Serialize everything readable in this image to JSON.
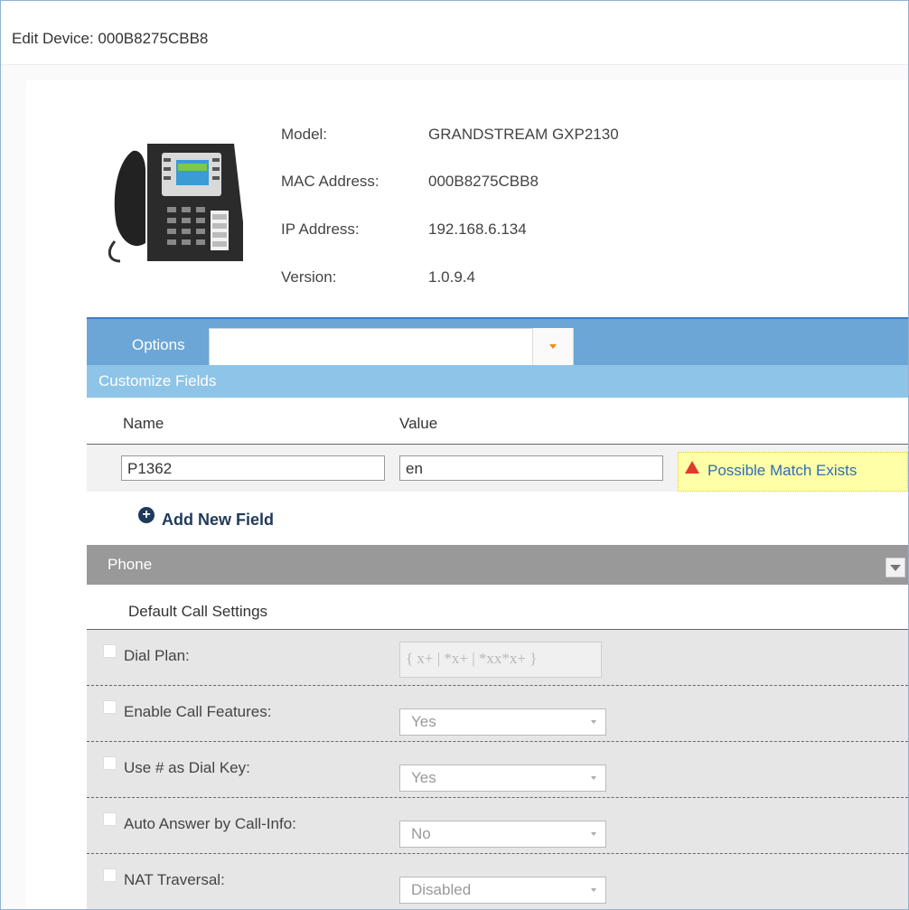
{
  "dialog": {
    "title": "Edit Device: 000B8275CBB8"
  },
  "device": {
    "model_label": "Model:",
    "model_value": "GRANDSTREAM GXP2130",
    "mac_label": "MAC Address:",
    "mac_value": "000B8275CBB8",
    "ip_label": "IP Address:",
    "ip_value": "192.168.6.134",
    "version_label": "Version:",
    "version_value": "1.0.9.4",
    "image_icon": "desk-phone-icon"
  },
  "options": {
    "label": "Options",
    "selected": ""
  },
  "customize": {
    "title": "Customize Fields",
    "col_name": "Name",
    "col_value": "Value",
    "row": {
      "name": "P1362",
      "value": "en",
      "warning": "Possible Match Exists"
    },
    "add_label": "Add New Field"
  },
  "phone_section": {
    "title": "Phone"
  },
  "call_settings": {
    "title": "Default Call Settings",
    "rows": [
      {
        "label": "Dial Plan:",
        "type": "text",
        "value": "{ x+ | *x+ | *xx*x+ }"
      },
      {
        "label": "Enable Call Features:",
        "type": "select",
        "value": "Yes"
      },
      {
        "label": "Use # as Dial Key:",
        "type": "select",
        "value": "Yes"
      },
      {
        "label": "Auto Answer by Call-Info:",
        "type": "select",
        "value": "No"
      },
      {
        "label": "NAT Traversal:",
        "type": "select",
        "value": "Disabled"
      }
    ]
  },
  "colors": {
    "options_bar": "#6ba6d6",
    "customize_bar": "#8ec4e8",
    "phone_bar": "#999999",
    "warning_bg": "#ffffa8",
    "link": "#2f6db5"
  }
}
